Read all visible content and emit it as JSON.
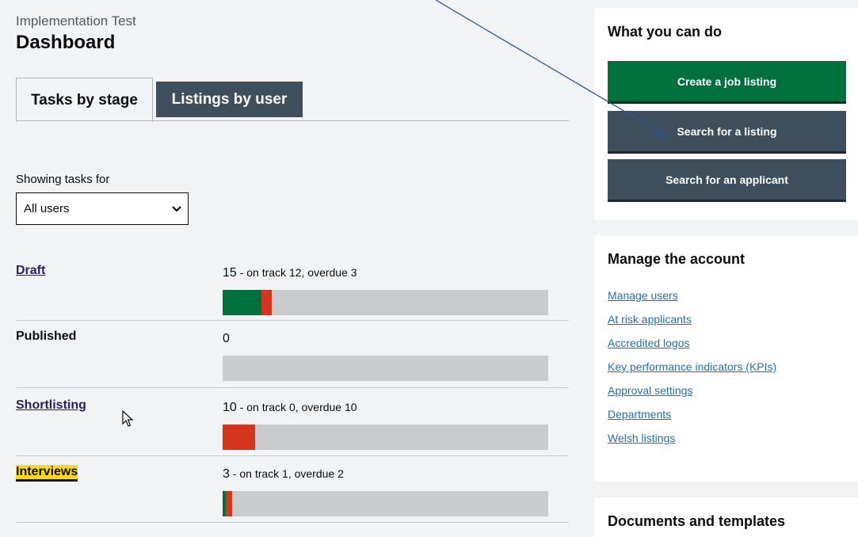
{
  "header": {
    "org_name": "Implementation Test",
    "page_title": "Dashboard"
  },
  "tabs": [
    {
      "label": "Tasks by stage",
      "active": true
    },
    {
      "label": "Listings by user",
      "active": false
    }
  ],
  "filter": {
    "label": "Showing tasks for",
    "selected": "All users"
  },
  "stages": [
    {
      "name": "Draft",
      "link": true,
      "highlight": false,
      "total": "15",
      "detail": "on track 12, overdue 3",
      "on_track": 12,
      "overdue": 3
    },
    {
      "name": "Published",
      "link": false,
      "highlight": false,
      "total": "0",
      "detail": "",
      "on_track": 0,
      "overdue": 0
    },
    {
      "name": "Shortlisting",
      "link": true,
      "highlight": false,
      "total": "10",
      "detail": "on track 0, overdue 10",
      "on_track": 0,
      "overdue": 10
    },
    {
      "name": "Interviews",
      "link": true,
      "highlight": true,
      "total": "3",
      "detail": "on track 1, overdue 2",
      "on_track": 1,
      "overdue": 2
    }
  ],
  "sidebar": {
    "actions": {
      "heading": "What you can do",
      "buttons": [
        "Create a job listing",
        "Search for a listing",
        "Search for an applicant"
      ]
    },
    "manage": {
      "heading": "Manage the account",
      "links": [
        "Manage users",
        "At risk applicants",
        "Accredited logos",
        "Key performance indicators (KPIs)",
        "Approval settings",
        "Departments",
        "Welsh listings"
      ]
    },
    "documents": {
      "heading": "Documents and templates"
    }
  },
  "colors": {
    "on_track": "#00703c",
    "overdue": "#d4351c",
    "bar_bg": "#c9cbcd",
    "primary_button": "#00703c",
    "secondary_button": "#3d4f5d"
  }
}
